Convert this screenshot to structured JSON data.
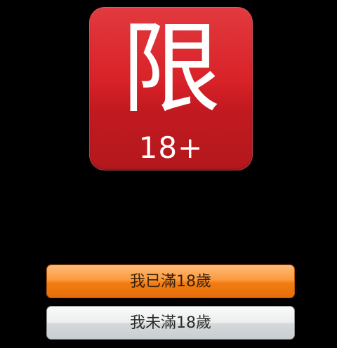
{
  "badge": {
    "glyph": "限",
    "age": "18+",
    "color": "#d82228"
  },
  "buttons": {
    "confirm_label": "我已滿18歲",
    "confirm_color": "#f27d14",
    "deny_label": "我未滿18歲",
    "deny_color": "#e4e6e7"
  }
}
